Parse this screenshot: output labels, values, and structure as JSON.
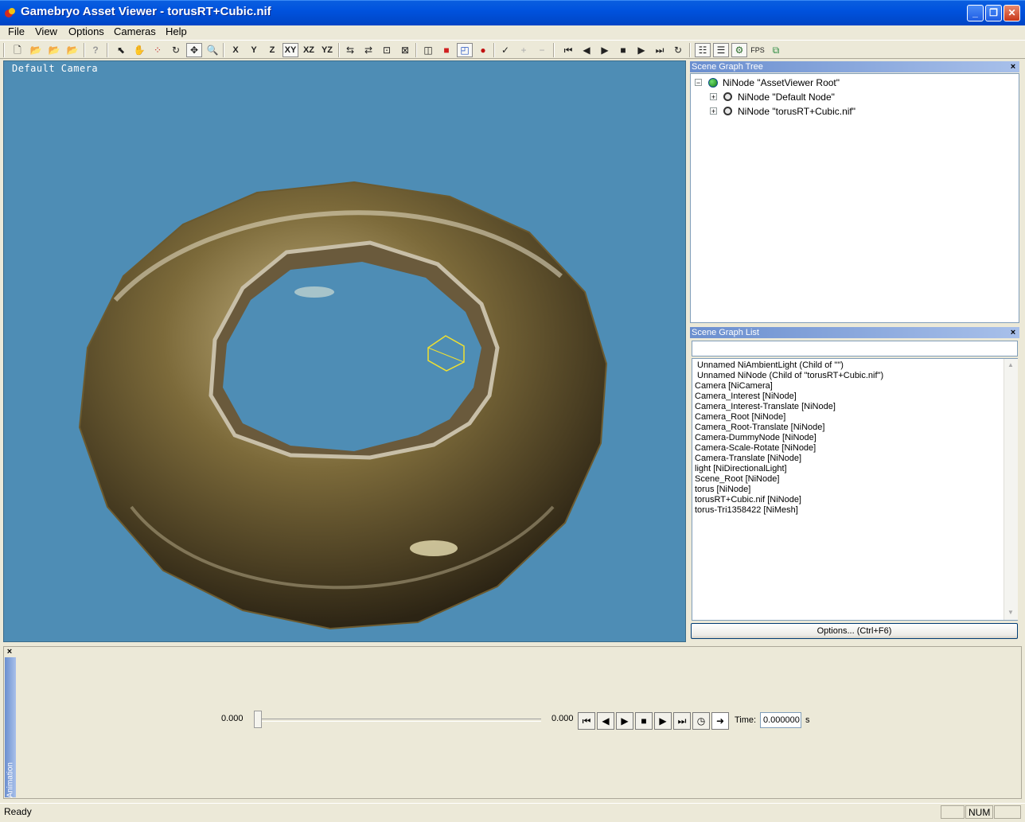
{
  "window": {
    "title": "Gamebryo Asset Viewer - torusRT+Cubic.nif",
    "controls": {
      "minimize": "_",
      "maximize": "❐",
      "close": "✕"
    }
  },
  "menu": [
    "File",
    "View",
    "Options",
    "Cameras",
    "Help"
  ],
  "toolbar": {
    "axes": [
      "X",
      "Y",
      "Z",
      "XY",
      "XZ",
      "YZ"
    ],
    "active_plane": "XY"
  },
  "viewport": {
    "camera_label": "Default Camera",
    "background_color": "#4e8db5"
  },
  "scene_graph_tree": {
    "title": "Scene Graph Tree",
    "nodes": [
      {
        "label": "NiNode \"AssetViewer Root\"",
        "expander": "−"
      },
      {
        "label": "NiNode \"Default Node\"",
        "expander": "+"
      },
      {
        "label": "NiNode \"torusRT+Cubic.nif\"",
        "expander": "+"
      }
    ]
  },
  "scene_graph_list": {
    "title": "Scene Graph List",
    "filter_value": "",
    "items": [
      "Unnamed NiAmbientLight (Child of \"\")",
      "Unnamed NiNode (Child of \"torusRT+Cubic.nif\")",
      "Camera [NiCamera]",
      "Camera_Interest [NiNode]",
      "Camera_Interest-Translate [NiNode]",
      "Camera_Root [NiNode]",
      "Camera_Root-Translate [NiNode]",
      "Camera-DummyNode [NiNode]",
      "Camera-Scale-Rotate [NiNode]",
      "Camera-Translate [NiNode]",
      "light [NiDirectionalLight]",
      "Scene_Root [NiNode]",
      "torus [NiNode]",
      "torusRT+Cubic.nif [NiNode]",
      "torus-Tri1358422 [NiMesh]"
    ],
    "options_button": "Options... (Ctrl+F6)"
  },
  "animation": {
    "tab_label": "Animation",
    "start_value": "0.000",
    "end_value": "0.000",
    "slider_fraction": 0,
    "time_label": "Time:",
    "time_value": "0.000000",
    "time_unit": "s"
  },
  "status": {
    "text": "Ready",
    "num": "NUM"
  },
  "close_glyph": "×"
}
